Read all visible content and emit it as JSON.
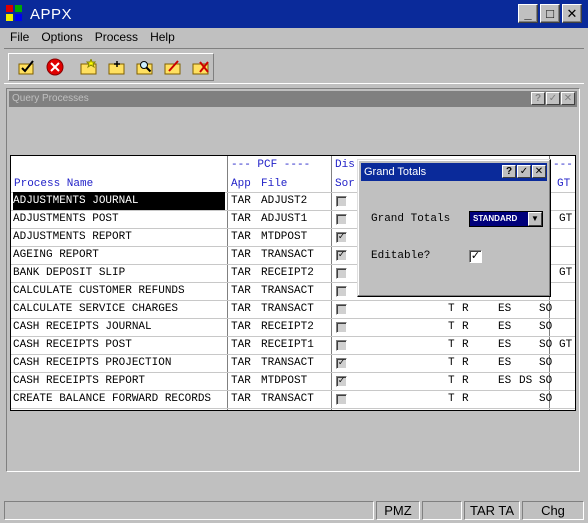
{
  "window": {
    "title": "APPX"
  },
  "window_buttons": {
    "minimize": "_",
    "maximize": "□",
    "close": "✕"
  },
  "menu": [
    "File",
    "Options",
    "Process",
    "Help"
  ],
  "toolbar_icons": [
    "check-folder-icon",
    "cancel-icon",
    "new-folder-icon",
    "add-folder-icon",
    "search-folder-icon",
    "edit-folder-icon",
    "delete-folder-icon"
  ],
  "mdi": {
    "title": "Query Processes",
    "buttons": {
      "help": "?",
      "ok": "✓",
      "close": "✕"
    }
  },
  "grid": {
    "headers": {
      "process_name": "Process Name",
      "pcf_group": "--- PCF ----",
      "app": "App",
      "file": "File",
      "dis_top": "Dis",
      "dis_bottom": "Sor",
      "gt_top": "---",
      "gt_bottom": "GT"
    },
    "rows": [
      {
        "name": "ADJUSTMENTS JOURNAL",
        "app": "TAR",
        "file": "ADJUST2",
        "checked": false,
        "flags": [
          "",
          "",
          "",
          "",
          ""
        ],
        "gt": ""
      },
      {
        "name": "ADJUSTMENTS POST",
        "app": "TAR",
        "file": "ADJUST1",
        "checked": false,
        "flags": [
          "",
          "",
          "",
          "",
          ""
        ],
        "gt": "GT"
      },
      {
        "name": "ADJUSTMENTS REPORT",
        "app": "TAR",
        "file": "MTDPOST",
        "checked": true,
        "flags": [
          "",
          "",
          "",
          "",
          ""
        ],
        "gt": ""
      },
      {
        "name": "AGEING REPORT",
        "app": "TAR",
        "file": "TRANSACT",
        "checked": true,
        "flags": [
          "",
          "",
          "",
          "",
          ""
        ],
        "gt": ""
      },
      {
        "name": "BANK DEPOSIT SLIP",
        "app": "TAR",
        "file": "RECEIPT2",
        "checked": false,
        "flags": [
          "",
          "",
          "",
          "",
          ""
        ],
        "gt": "GT"
      },
      {
        "name": "CALCULATE CUSTOMER REFUNDS",
        "app": "TAR",
        "file": "TRANSACT",
        "checked": false,
        "flags": [
          "",
          "",
          "",
          "",
          ""
        ],
        "gt": ""
      },
      {
        "name": "CALCULATE SERVICE CHARGES",
        "app": "TAR",
        "file": "TRANSACT",
        "checked": false,
        "flags": [
          "T",
          "R",
          "ES",
          "",
          "SO"
        ],
        "gt": ""
      },
      {
        "name": "CASH RECEIPTS JOURNAL",
        "app": "TAR",
        "file": "RECEIPT2",
        "checked": false,
        "flags": [
          "T",
          "R",
          "ES",
          "",
          "SO"
        ],
        "gt": ""
      },
      {
        "name": "CASH RECEIPTS POST",
        "app": "TAR",
        "file": "RECEIPT1",
        "checked": false,
        "flags": [
          "T",
          "R",
          "ES",
          "",
          "SO"
        ],
        "gt": "GT"
      },
      {
        "name": "CASH RECEIPTS PROJECTION",
        "app": "TAR",
        "file": "TRANSACT",
        "checked": true,
        "flags": [
          "T",
          "R",
          "ES",
          "",
          "SO"
        ],
        "gt": ""
      },
      {
        "name": "CASH RECEIPTS REPORT",
        "app": "TAR",
        "file": "MTDPOST",
        "checked": true,
        "flags": [
          "T",
          "R",
          "ES",
          "DS",
          "SO"
        ],
        "gt": ""
      },
      {
        "name": "CREATE BALANCE FORWARD RECORDS",
        "app": "TAR",
        "file": "TRANSACT",
        "checked": false,
        "flags": [
          "T",
          "R",
          "",
          "",
          "SO"
        ],
        "gt": ""
      }
    ]
  },
  "dialog": {
    "title": "Grand Totals",
    "buttons": {
      "help": "?",
      "ok": "✓",
      "close": "✕"
    },
    "grand_totals_label": "Grand Totals",
    "grand_totals_value": "STANDARD",
    "editable_label": "Editable?",
    "editable_checked": true
  },
  "statusbar": [
    "",
    "PMZ",
    "",
    "TAR TA",
    "Chg"
  ],
  "colors": {
    "title_bar": "#0a2a9a",
    "header_text": "#2222c8",
    "chrome": "#c0c0c0"
  }
}
